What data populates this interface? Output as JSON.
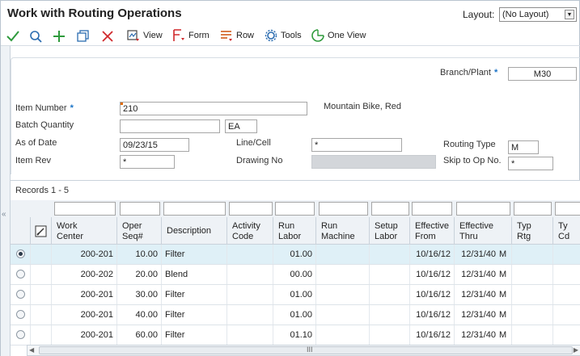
{
  "header": {
    "title": "Work with Routing Operations",
    "layout_label": "Layout:",
    "layout_value": "(No Layout)"
  },
  "toolbar": {
    "icons": [
      "checkmark-icon",
      "search-icon",
      "plus-icon",
      "copy-icon",
      "close-icon"
    ],
    "view_label": "View",
    "form_label": "Form",
    "row_label": "Row",
    "tools_label": "Tools",
    "oneview_label": "One View"
  },
  "form": {
    "branch_plant_label": "Branch/Plant",
    "branch_plant_value": "M30",
    "item_number_label": "Item Number",
    "item_number_value": "210",
    "item_description": "Mountain Bike, Red",
    "batch_quantity_label": "Batch Quantity",
    "batch_quantity_value": "",
    "batch_uom_value": "EA",
    "as_of_date_label": "As of Date",
    "as_of_date_value": "09/23/15",
    "line_cell_label": "Line/Cell",
    "line_cell_value": "*",
    "routing_type_label": "Routing Type",
    "routing_type_value": "M",
    "item_rev_label": "Item Rev",
    "item_rev_value": "*",
    "drawing_no_label": "Drawing No",
    "drawing_no_value": "",
    "skip_to_op_label": "Skip to Op No.",
    "skip_to_op_value": "*"
  },
  "grid": {
    "records_label": "Records 1 - 5",
    "columns": [
      {
        "l1": "Work",
        "l2": "Center"
      },
      {
        "l1": "Oper",
        "l2": "Seq#"
      },
      {
        "l1": "Description",
        "l2": ""
      },
      {
        "l1": "Activity",
        "l2": "Code"
      },
      {
        "l1": "Run",
        "l2": "Labor"
      },
      {
        "l1": "Run",
        "l2": "Machine"
      },
      {
        "l1": "Setup",
        "l2": "Labor"
      },
      {
        "l1": "Effective",
        "l2": "From"
      },
      {
        "l1": "Effective",
        "l2": "Thru"
      },
      {
        "l1": "Typ",
        "l2": "Rtg"
      },
      {
        "l1": "Ty",
        "l2": "Cd"
      }
    ],
    "rows": [
      {
        "selected": true,
        "work_center": "200-201",
        "oper_seq": "10.00",
        "description": "Filter",
        "activity": "",
        "run_labor": "01.00",
        "run_machine": "",
        "setup_labor": "",
        "eff_from": "10/16/12",
        "eff_thru": "12/31/40",
        "typ_rtg": "M",
        "ty_cd": ""
      },
      {
        "selected": false,
        "work_center": "200-202",
        "oper_seq": "20.00",
        "description": "Blend",
        "activity": "",
        "run_labor": "00.00",
        "run_machine": "",
        "setup_labor": "",
        "eff_from": "10/16/12",
        "eff_thru": "12/31/40",
        "typ_rtg": "M",
        "ty_cd": ""
      },
      {
        "selected": false,
        "work_center": "200-201",
        "oper_seq": "30.00",
        "description": "Filter",
        "activity": "",
        "run_labor": "01.00",
        "run_machine": "",
        "setup_labor": "",
        "eff_from": "10/16/12",
        "eff_thru": "12/31/40",
        "typ_rtg": "M",
        "ty_cd": ""
      },
      {
        "selected": false,
        "work_center": "200-201",
        "oper_seq": "40.00",
        "description": "Filter",
        "activity": "",
        "run_labor": "01.00",
        "run_machine": "",
        "setup_labor": "",
        "eff_from": "10/16/12",
        "eff_thru": "12/31/40",
        "typ_rtg": "M",
        "ty_cd": ""
      },
      {
        "selected": false,
        "work_center": "200-201",
        "oper_seq": "60.00",
        "description": "Filter",
        "activity": "",
        "run_labor": "01.10",
        "run_machine": "",
        "setup_labor": "",
        "eff_from": "10/16/12",
        "eff_thru": "12/31/40",
        "typ_rtg": "M",
        "ty_cd": ""
      }
    ]
  },
  "colors": {
    "accent_green": "#2e9a3c",
    "close_red": "#d0282b",
    "icon_blue": "#2b6cb0",
    "selected_row": "#dff0f7"
  }
}
